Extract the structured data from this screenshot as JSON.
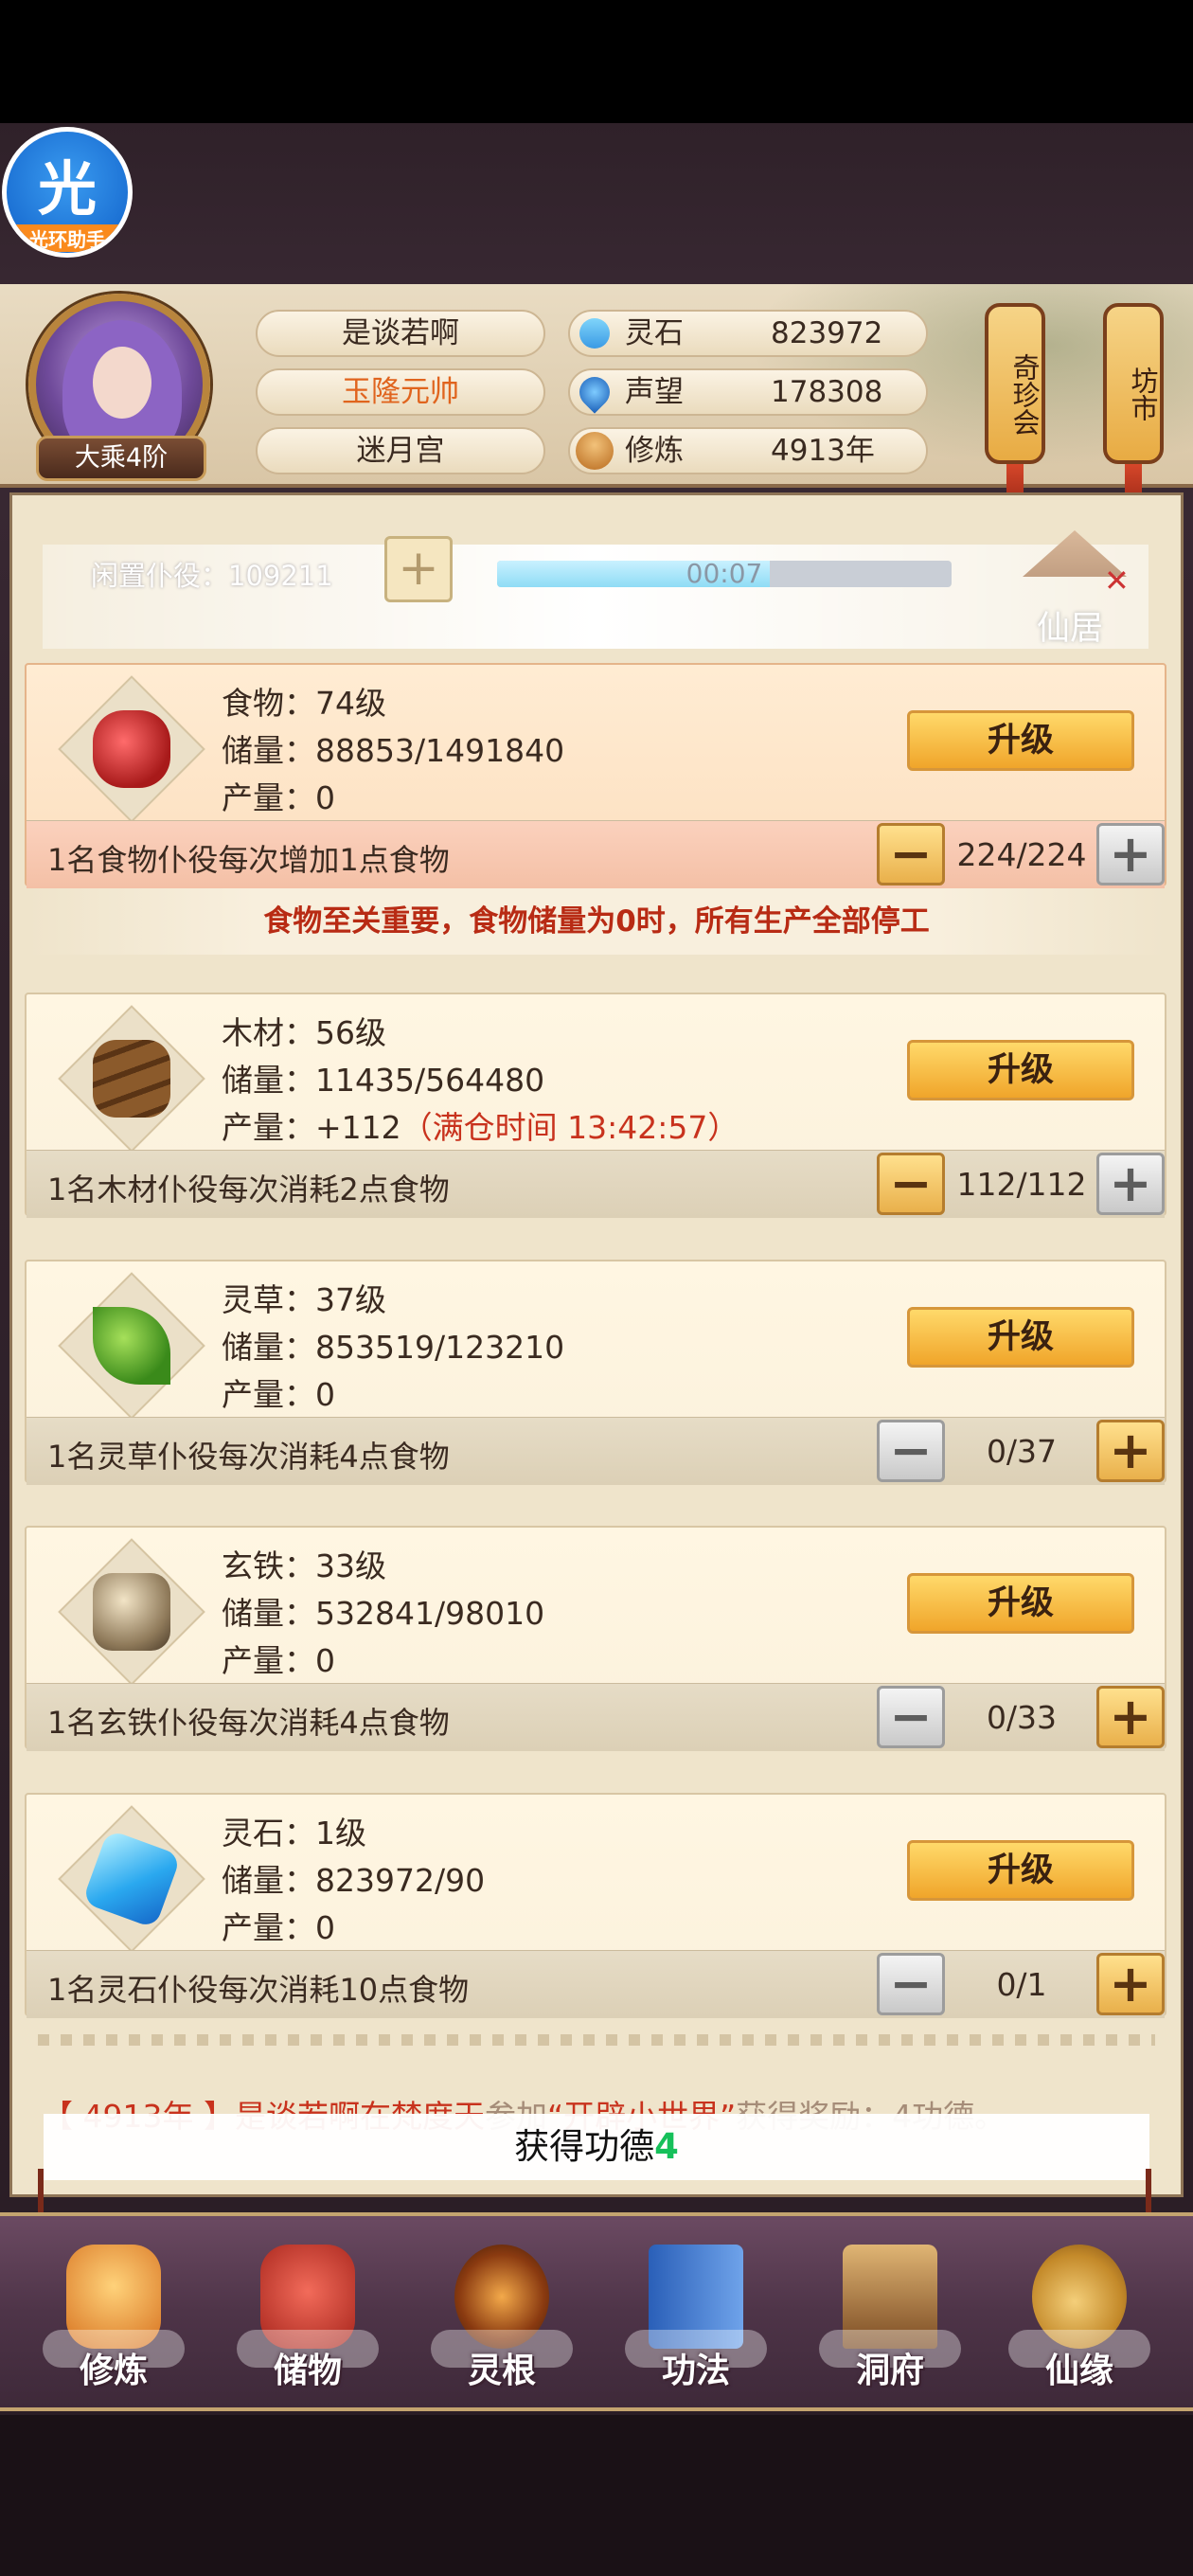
{
  "helper": {
    "big": "光",
    "small": "光环助手"
  },
  "player": {
    "name": "是谈若啊",
    "title": "玉隆元帅",
    "sect": "迷月宫",
    "rank": "大乘4阶"
  },
  "stats": [
    {
      "label": "灵石",
      "value": "823972",
      "icon": "spirit-stone-icon",
      "color": "#3aa7e8"
    },
    {
      "label": "声望",
      "value": "178308",
      "icon": "water-drop-icon",
      "color": "#2a7fd8"
    },
    {
      "label": "修炼",
      "value": "4913年",
      "icon": "meditation-icon",
      "color": "#d9923a"
    }
  ],
  "lanterns": [
    {
      "label": "奇珍会"
    },
    {
      "label": "坊市"
    }
  ],
  "idle": {
    "text": "闲置仆役：109211",
    "timer": "00:07",
    "progress": 0.6
  },
  "home": {
    "label": "仙居"
  },
  "resources": [
    {
      "name": "食物：74级",
      "storage": "储量：88853/1491840",
      "output": "产量：0",
      "output_extra": "",
      "upgrade": "升级",
      "rule": "1名食物仆役每次增加1点食物",
      "ratio": "224/224",
      "minus_active": true,
      "plus_active": false
    },
    {
      "name": "木材：56级",
      "storage": "储量：11435/564480",
      "output": "产量：+112",
      "output_extra": "（满仓时间 13:42:57）",
      "upgrade": "升级",
      "rule": "1名木材仆役每次消耗2点食物",
      "ratio": "112/112",
      "minus_active": true,
      "plus_active": false
    },
    {
      "name": "灵草：37级",
      "storage": "储量：853519/123210",
      "output": "产量：0",
      "output_extra": "",
      "upgrade": "升级",
      "rule": "1名灵草仆役每次消耗4点食物",
      "ratio": "0/37",
      "minus_active": false,
      "plus_active": true
    },
    {
      "name": "玄铁：33级",
      "storage": "储量：532841/98010",
      "output": "产量：0",
      "output_extra": "",
      "upgrade": "升级",
      "rule": "1名玄铁仆役每次消耗4点食物",
      "ratio": "0/33",
      "minus_active": false,
      "plus_active": true
    },
    {
      "name": "灵石：1级",
      "storage": "储量：823972/90",
      "output": "产量：0",
      "output_extra": "",
      "upgrade": "升级",
      "rule": "1名灵石仆役每次消耗10点食物",
      "ratio": "0/1",
      "minus_active": false,
      "plus_active": true
    }
  ],
  "warning": "食物至关重要，食物储量为0时，所有生产全部停工",
  "log": {
    "year": "【 4913年 】",
    "who": "是谈若啊在梵度天",
    "mid": "参加",
    "event": "“开辟小世界”",
    "rest": "获得奖励：4功德。"
  },
  "toast": {
    "text": "获得功德",
    "num": "4"
  },
  "nav": [
    {
      "label": "修炼",
      "icon": "monk-icon"
    },
    {
      "label": "储物",
      "icon": "bag-icon"
    },
    {
      "label": "灵根",
      "icon": "spirit-root-icon"
    },
    {
      "label": "功法",
      "icon": "book-icon"
    },
    {
      "label": "洞府",
      "icon": "cave-house-icon"
    },
    {
      "label": "仙缘",
      "icon": "gourd-icon"
    }
  ]
}
